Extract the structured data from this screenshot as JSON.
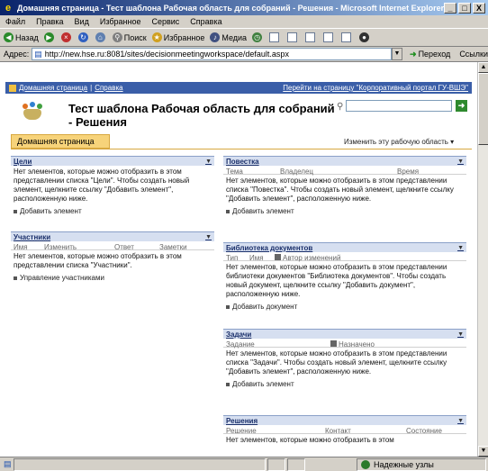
{
  "window": {
    "title": "Домашняя страница - Тест шаблона Рабочая область для собраний - Решения - Microsoft Internet Explorer",
    "minimize": "_",
    "maximize": "□",
    "close": "X"
  },
  "menu": [
    "Файл",
    "Правка",
    "Вид",
    "Избранное",
    "Сервис",
    "Справка"
  ],
  "toolbar": {
    "back": "Назад",
    "forward": "",
    "search": "Поиск",
    "favorites": "Избранное",
    "media": "Медиа"
  },
  "address": {
    "label": "Адрес:",
    "url": "http://new.hse.ru:8081/sites/decisionmeetingworkspace/default.aspx",
    "go": "Переход",
    "links": "Ссылки"
  },
  "sp": {
    "breadcrumb_home": "Домашняя страница",
    "breadcrumb_help": "Справка",
    "portal_link": "Перейти на страницу \"Корпоративный портал ГУ-ВШЭ\"",
    "title": "Тест шаблона Рабочая область для собраний - Решения",
    "tab_home": "Домашняя страница",
    "edit_workspace": "Изменить эту рабочую область ▾"
  },
  "goals": {
    "title": "Цели",
    "empty": "Нет элементов, которые можно отобразить в этом представлении списка \"Цели\". Чтобы создать новый элемент, щелкните ссылку \"Добавить элемент\", расположенную ниже.",
    "add": "Добавить элемент"
  },
  "participants": {
    "title": "Участники",
    "cols": [
      "Имя",
      "Изменить",
      "Ответ",
      "Заметки"
    ],
    "empty": "Нет элементов, которые можно отобразить в этом представлении списка \"Участники\".",
    "add": "Управление участниками"
  },
  "agenda": {
    "title": "Повестка",
    "cols": [
      "Тема",
      "Владелец",
      "Время"
    ],
    "empty": "Нет элементов, которые можно отобразить в этом представлении списка \"Повестка\". Чтобы создать новый элемент, щелкните ссылку \"Добавить элемент\", расположенную ниже.",
    "add": "Добавить элемент"
  },
  "docs": {
    "title": "Библиотека документов",
    "cols": [
      "Тип",
      "Имя",
      "Автор изменений"
    ],
    "empty": "Нет элементов, которые можно отобразить в этом представлении библиотеки документов \"Библиотека документов\". Чтобы создать новый документ, щелкните ссылку \"Добавить документ\", расположенную ниже.",
    "add": "Добавить документ"
  },
  "tasks": {
    "title": "Задачи",
    "cols": [
      "Задание",
      "Назначено"
    ],
    "empty": "Нет элементов, которые можно отобразить в этом представлении списка \"Задачи\". Чтобы создать новый элемент, щелкните ссылку \"Добавить элемент\", расположенную ниже.",
    "add": "Добавить элемент"
  },
  "decisions": {
    "title": "Решения",
    "cols": [
      "Решение",
      "Контакт",
      "Состояние"
    ],
    "empty": "Нет элементов, которые можно отобразить в этом"
  },
  "status": {
    "zone": "Надежные узлы"
  }
}
